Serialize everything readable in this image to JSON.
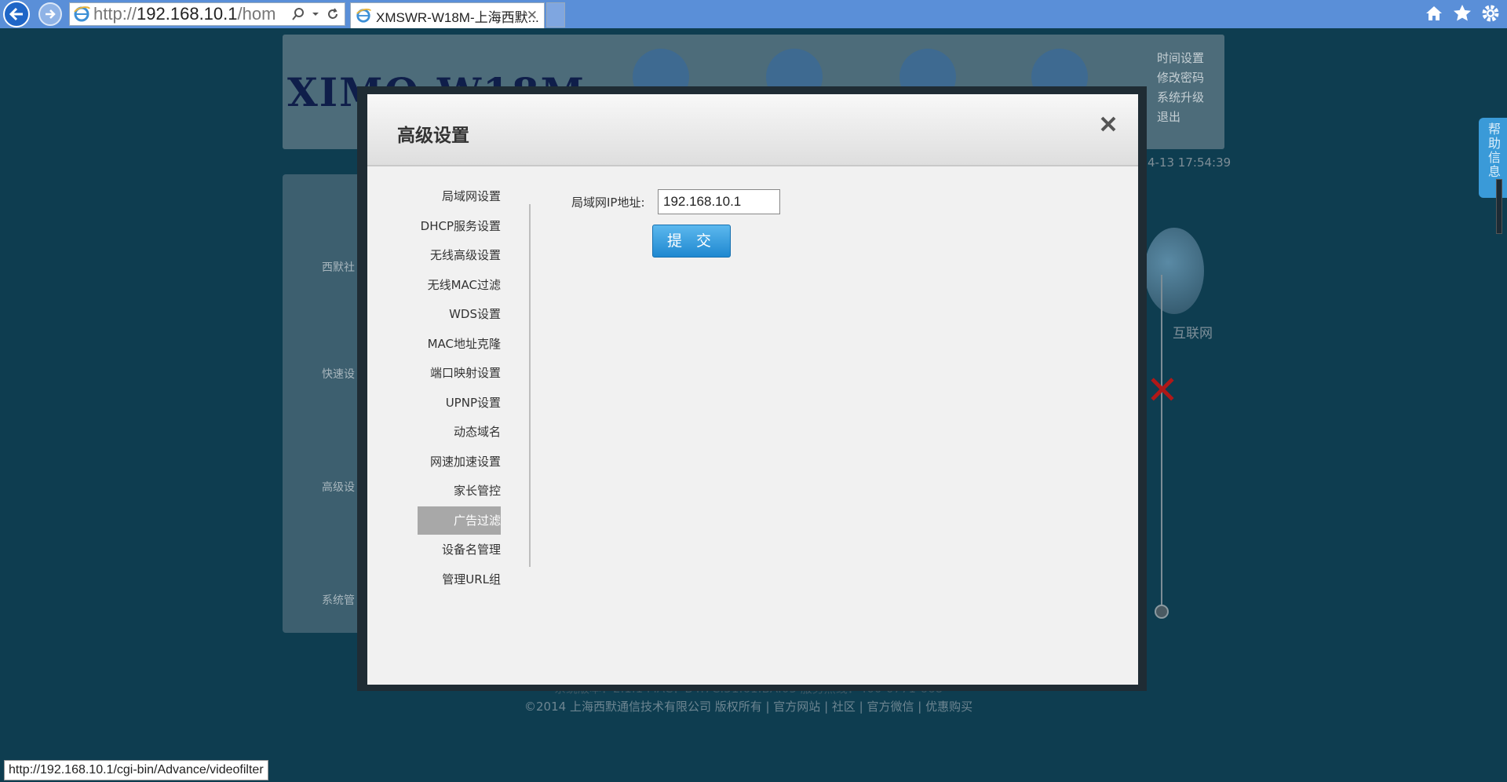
{
  "browser": {
    "url_prefix": "http://",
    "url_host": "192.168.10.1",
    "url_rest": "/hom",
    "tab_title": "XMSWR-W18M-上海西默...",
    "status_url": "http://192.168.10.1/cgi-bin/Advance/videofilter"
  },
  "background": {
    "logo": "XIMO-W18M",
    "top_menu": [
      "时间设置",
      "修改密码",
      "系统升级",
      "退出"
    ],
    "datetime": "4-13 17:54:39",
    "sidebar": [
      "西默社",
      "快速设",
      "高级设",
      "系统管"
    ],
    "internet_label": "互联网",
    "footer_version": "系统版本：2.1.1  MAC：B4:7C:51:61:BA:05  服务热线：400-0771-668",
    "footer_copyright": "©2014 上海西默通信技术有限公司 版权所有 | 官方网站 | 社区 | 官方微信 | 优惠购买",
    "help_tab": "帮助信息"
  },
  "modal": {
    "title": "高级设置",
    "menu": [
      {
        "label": "局域网设置",
        "active": false
      },
      {
        "label": "DHCP服务设置",
        "active": false
      },
      {
        "label": "无线高级设置",
        "active": false
      },
      {
        "label": "无线MAC过滤",
        "active": false
      },
      {
        "label": "WDS设置",
        "active": false
      },
      {
        "label": "MAC地址克隆",
        "active": false
      },
      {
        "label": "端口映射设置",
        "active": false
      },
      {
        "label": "UPNP设置",
        "active": false
      },
      {
        "label": "动态域名",
        "active": false
      },
      {
        "label": "网速加速设置",
        "active": false
      },
      {
        "label": "家长管控",
        "active": false
      },
      {
        "label": "广告过滤",
        "active": true
      },
      {
        "label": "设备名管理",
        "active": false
      },
      {
        "label": "管理URL组",
        "active": false
      }
    ],
    "lan_ip_label": "局域网IP地址:",
    "lan_ip_value": "192.168.10.1",
    "submit_label": "提 交"
  },
  "colors": {
    "browser_chrome": "#5a8fd8",
    "page_bg": "#0e3d50",
    "submit": "#1f88d0",
    "active_menu": "#a8a8a8"
  }
}
